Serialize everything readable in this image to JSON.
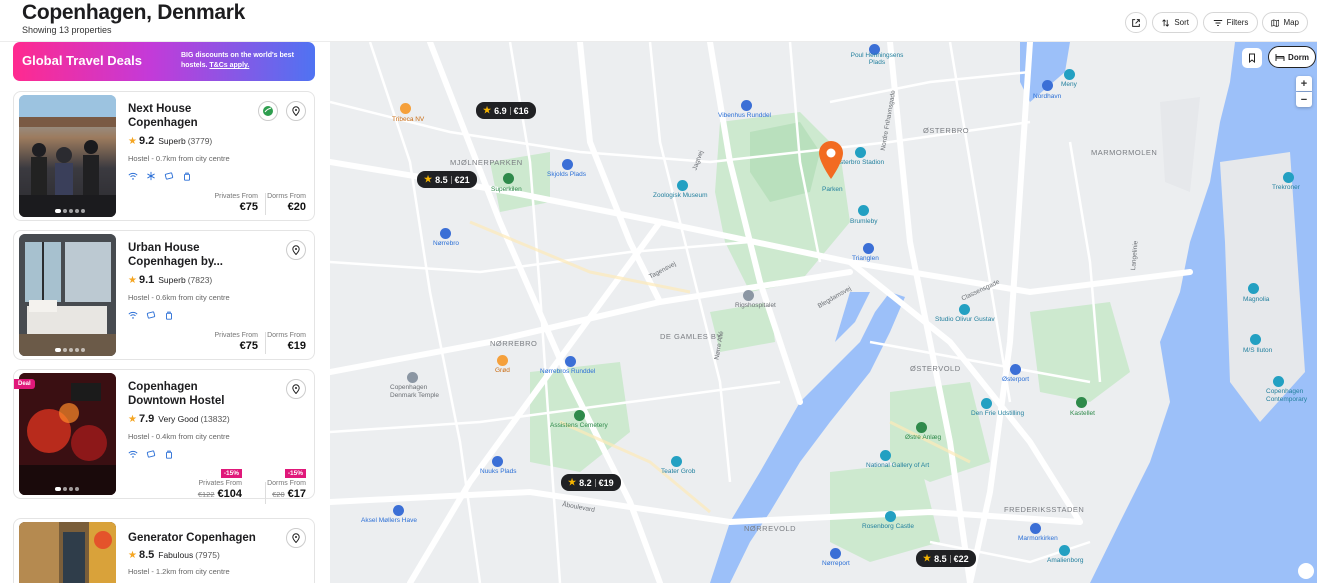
{
  "header": {
    "title": "Copenhagen, Denmark",
    "subtitle": "Showing 13 properties",
    "sort_label": "Sort",
    "filters_label": "Filters",
    "map_label": "Map"
  },
  "banner": {
    "title": "Global Travel Deals",
    "text": "BIG discounts on the world's best hostels.",
    "link": "T&Cs apply."
  },
  "properties": [
    {
      "name": "Next House Copenhagen",
      "score": "9.2",
      "rating_word": "Superb",
      "reviews": "(3779)",
      "meta": "Hostel - 0.7km from city centre",
      "privates_label": "Privates From",
      "privates_price": "€75",
      "dorms_label": "Dorms From",
      "dorms_price": "€20"
    },
    {
      "name": "Urban House Copenhagen by...",
      "score": "9.1",
      "rating_word": "Superb",
      "reviews": "(7823)",
      "meta": "Hostel - 0.6km from city centre",
      "privates_label": "Privates From",
      "privates_price": "€75",
      "dorms_label": "Dorms From",
      "dorms_price": "€19"
    },
    {
      "name": "Copenhagen Downtown Hostel",
      "deal": "Deal",
      "score": "7.9",
      "rating_word": "Very Good",
      "reviews": "(13832)",
      "meta": "Hostel - 0.4km from city centre",
      "privates_discount": "-15%",
      "privates_label": "Privates From",
      "privates_old": "€122",
      "privates_price": "€104",
      "dorms_discount": "-15%",
      "dorms_label": "Dorms From",
      "dorms_old": "€20",
      "dorms_price": "€17"
    },
    {
      "name": "Generator Copenhagen",
      "score": "8.5",
      "rating_word": "Fabulous",
      "reviews": "(7975)",
      "meta": "Hostel - 1.2km from city centre"
    }
  ],
  "map": {
    "dorm_toggle": "Dorm",
    "zoom_in": "+",
    "zoom_out": "−",
    "price_tags": [
      {
        "score": "6.9",
        "price": "€16"
      },
      {
        "score": "8.5",
        "price": "€21"
      },
      {
        "score": "8.2",
        "price": "€19"
      },
      {
        "score": "8.5",
        "price": "€22"
      }
    ],
    "labels": {
      "poul": "Poul Henningsens Plads",
      "tribeca": "Tribeca NV",
      "mjolner": "MJØLNERPARKEN",
      "superkilen": "Superkilen",
      "skjolds": "Skjolds Plads",
      "vibenhus": "Vibenhus Runddel",
      "zoologisk": "Zoologisk Museum",
      "osterbro": "ØSTERBRO",
      "osterbro_stadion": "Østerbro Stadion",
      "parken": "Parken",
      "brumleby": "Brumleby",
      "trianglen": "Trianglen",
      "norrebro_st": "Nørrebro",
      "rigshospitalet": "Rigshospitalet",
      "norrebro": "NØRREBRO",
      "de_gamles_by": "DE GAMLES BY",
      "norrebros_runddel": "Nørrebros Runddel",
      "grod": "Grød",
      "cph_temple": "Copenhagen Denmark Temple",
      "assistens": "Assistens Cemetery",
      "nuuks": "Nuuks Plads",
      "teater": "Teater Grob",
      "aksel": "Aksel Møllers Have",
      "norrevold": "NØRREVOLD",
      "norreport": "Nørreport",
      "rosenborg": "Rosenborg Castle",
      "national_gallery": "National Gallery of Art",
      "ostre_anlaeg": "Østre Anlæg",
      "ostervold": "ØSTERVOLD",
      "osterport": "Østerport",
      "den_frie": "Den Frie Udstilling",
      "kastellet": "Kastellet",
      "studio_olivur": "Studio Olivur Gustav",
      "frederiksstaden": "FREDERIKSSTADEN",
      "marmorkirken": "Marmorkirken",
      "amalienborg": "Amalienborg",
      "nordhavn": "Nordhavn",
      "marmormolen": "MARMORMOLEN",
      "meny": "Meny",
      "magnolia": "Magnolia",
      "ms_iluton": "M/S Iluton",
      "cph_contemporary": "Copenhagen Contemporary",
      "trekroner": "Trekroner",
      "langelinie": "Langelinie",
      "nordre_frihavn": "Nordre Frihavnsgade",
      "classengade": "Classensgade",
      "jagtvej": "Jagtvej",
      "blegdamsvej": "Blegdamsvej",
      "norre_alle": "Nørre Allé",
      "tagensvej": "Tagensvej",
      "aboulevard": "Åboulevard"
    }
  }
}
